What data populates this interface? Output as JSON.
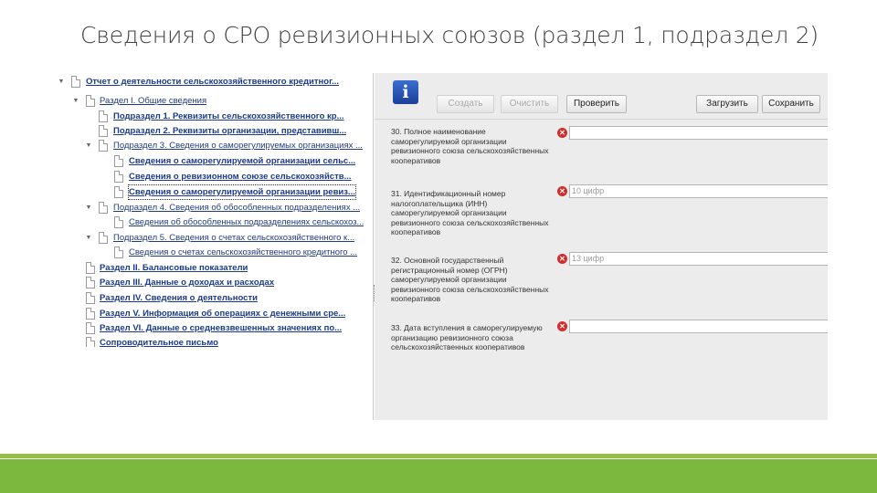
{
  "slide": {
    "title": "Сведения о СРО ревизионных союзов (раздел 1, подраздел 2)"
  },
  "tree": {
    "items": [
      {
        "label": "Отчет о деятельности сельскохозяйственного кредитног...",
        "style": "bold"
      },
      {
        "label": "Раздел I. Общие сведения",
        "style": "plain"
      },
      {
        "label": "Подраздел 1. Реквизиты сельскохозяйственного кр...",
        "style": "bold"
      },
      {
        "label": "Подраздел 2. Реквизиты организации, представивш...",
        "style": "bold"
      },
      {
        "label": "Подраздел 3. Сведения о саморегулируемых организациях ...",
        "style": "plain"
      },
      {
        "label": "Сведения о саморегулируемой организации сельс...",
        "style": "bold"
      },
      {
        "label": "Сведения о ревизионном союзе сельскохозяйств...",
        "style": "bold"
      },
      {
        "label": "Сведения о саморегулируемой организации ревиз...",
        "style": "bold"
      },
      {
        "label": "Подраздел 4. Сведения об обособленных подразделениях ...",
        "style": "plain"
      },
      {
        "label": "Сведения об обособленных подразделениях сельскохоз...",
        "style": "plain"
      },
      {
        "label": "Подраздел 5. Сведения о счетах сельскохозяйственного к...",
        "style": "plain"
      },
      {
        "label": "Сведения о счетах сельскохозяйственного кредитного ...",
        "style": "plain"
      },
      {
        "label": "Раздел II. Балансовые показатели",
        "style": "bold"
      },
      {
        "label": "Раздел III. Данные о доходах и расходах",
        "style": "bold"
      },
      {
        "label": "Раздел IV. Сведения о деятельности",
        "style": "bold"
      },
      {
        "label": "Раздел V. Информация об операциях с денежными сре...",
        "style": "bold"
      },
      {
        "label": "Раздел VI. Данные о средневзвешенных значениях по...",
        "style": "bold"
      },
      {
        "label": "Сопроводительное письмо",
        "style": "bold"
      }
    ]
  },
  "toolbar": {
    "info_icon": "info-icon",
    "create_label": "Создать",
    "clear_label": "Очистить",
    "check_label": "Проверить",
    "load_label": "Загрузить",
    "save_label": "Сохранить"
  },
  "fields": [
    {
      "label": "30. Полное наименование саморегулируемой организации ревизионного союза сельскохозяйственных кооперативов",
      "value": ""
    },
    {
      "label": "31. Идентификационный номер налогоплательщика (ИНН) саморегулируемой организации ревизионного союза сельскохозяйственных кооперативов",
      "value": "10 цифр"
    },
    {
      "label": "32. Основной государственный регистрационный номер (ОГРН) саморегулируемой организации ревизионного союза сельскохозяйственных кооперативов",
      "value": "13 цифр"
    },
    {
      "label": "33. Дата вступления в саморегулируемую организацию ревизионного союза сельскохозяйственных кооперативов",
      "value": ""
    }
  ],
  "colors": {
    "accent_green": "#7cb83d",
    "link_blue": "#1b3a8c",
    "error_red": "#d42b2b"
  }
}
